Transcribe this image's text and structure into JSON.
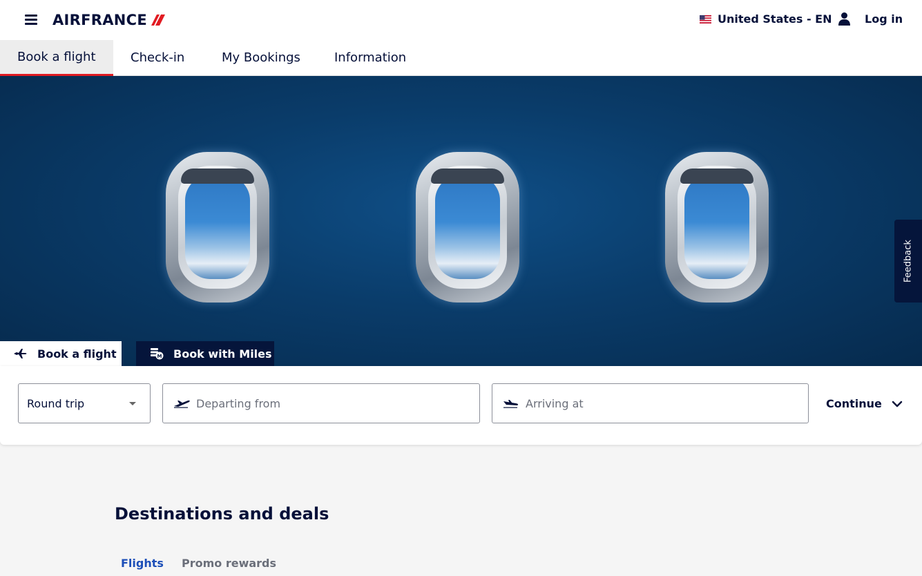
{
  "header": {
    "logo_text": "AIRFRANCE",
    "locale_label": "United States - EN",
    "login_label": "Log in",
    "icons": {
      "menu": "hamburger-icon",
      "user": "user-icon",
      "flag": "us-flag-icon"
    }
  },
  "nav": {
    "tabs": [
      {
        "label": "Book a flight",
        "active": true
      },
      {
        "label": "Check-in",
        "active": false
      },
      {
        "label": "My Bookings",
        "active": false
      },
      {
        "label": "Information",
        "active": false
      }
    ]
  },
  "feedback_label": "Feedback",
  "booking": {
    "tabs": [
      {
        "label": "Book a flight",
        "icon": "plane-icon",
        "active": true
      },
      {
        "label": "Book with Miles",
        "icon": "miles-icon",
        "active": false
      }
    ],
    "trip_type": "Round trip",
    "departing_placeholder": "Departing from",
    "arriving_placeholder": "Arriving at",
    "continue_label": "Continue"
  },
  "deals": {
    "title": "Destinations and deals",
    "tabs": [
      {
        "label": "Flights",
        "active": true
      },
      {
        "label": "Promo rewards",
        "active": false
      }
    ]
  },
  "colors": {
    "brand_navy": "#051039",
    "accent_red": "#e11b22",
    "link_blue": "#1d4fb8"
  }
}
